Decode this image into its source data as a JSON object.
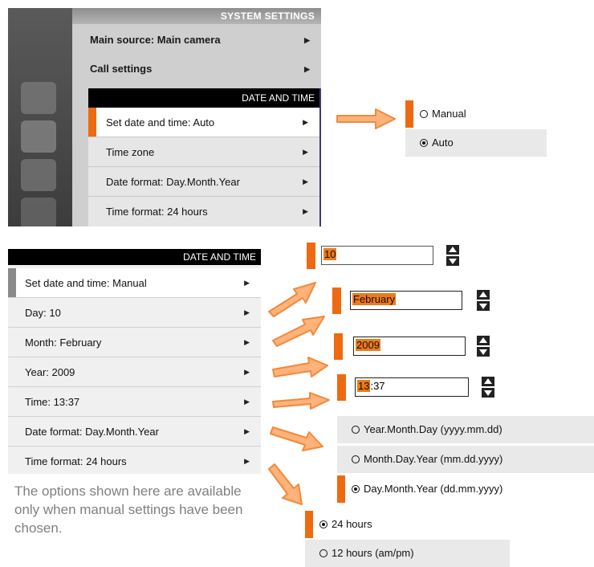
{
  "system_settings": {
    "header": "SYSTEM SETTINGS",
    "items": [
      {
        "label": "Main source: Main camera"
      },
      {
        "label": "Call settings"
      }
    ],
    "date_time_panel": {
      "header": "DATE AND TIME",
      "items": [
        {
          "label": "Set date and time: Auto"
        },
        {
          "label": "Time zone"
        },
        {
          "label": "Date format: Day.Month.Year"
        },
        {
          "label": "Time format: 24 hours"
        }
      ]
    }
  },
  "set_mode_options": [
    {
      "label": "Manual",
      "selected": false
    },
    {
      "label": "Auto",
      "selected": true
    }
  ],
  "date_time_menu": {
    "header": "DATE AND TIME",
    "items": [
      {
        "label": "Set date and time: Manual"
      },
      {
        "label": "Day: 10"
      },
      {
        "label": "Month: February"
      },
      {
        "label": "Year: 2009"
      },
      {
        "label": "Time: 13:37"
      },
      {
        "label": "Date format: Day.Month.Year"
      },
      {
        "label": "Time format: 24 hours"
      }
    ]
  },
  "fields": {
    "day": "10",
    "month": "February",
    "year": "2009",
    "time_hour": "13",
    "time_rest": ":37"
  },
  "date_format_options": [
    {
      "label": "Year.Month.Day (yyyy.mm.dd)",
      "selected": false
    },
    {
      "label": "Month.Day.Year (mm.dd.yyyy)",
      "selected": false
    },
    {
      "label": "Day.Month.Year (dd.mm.yyyy)",
      "selected": true
    }
  ],
  "time_format_options": [
    {
      "label": "24 hours",
      "selected": true
    },
    {
      "label": "12 hours (am/pm)",
      "selected": false
    }
  ],
  "note": "The options shown here are available only when manual settings have been chosen.",
  "colors": {
    "accent": "#ee6a10",
    "arrow": "#f08a3c"
  }
}
